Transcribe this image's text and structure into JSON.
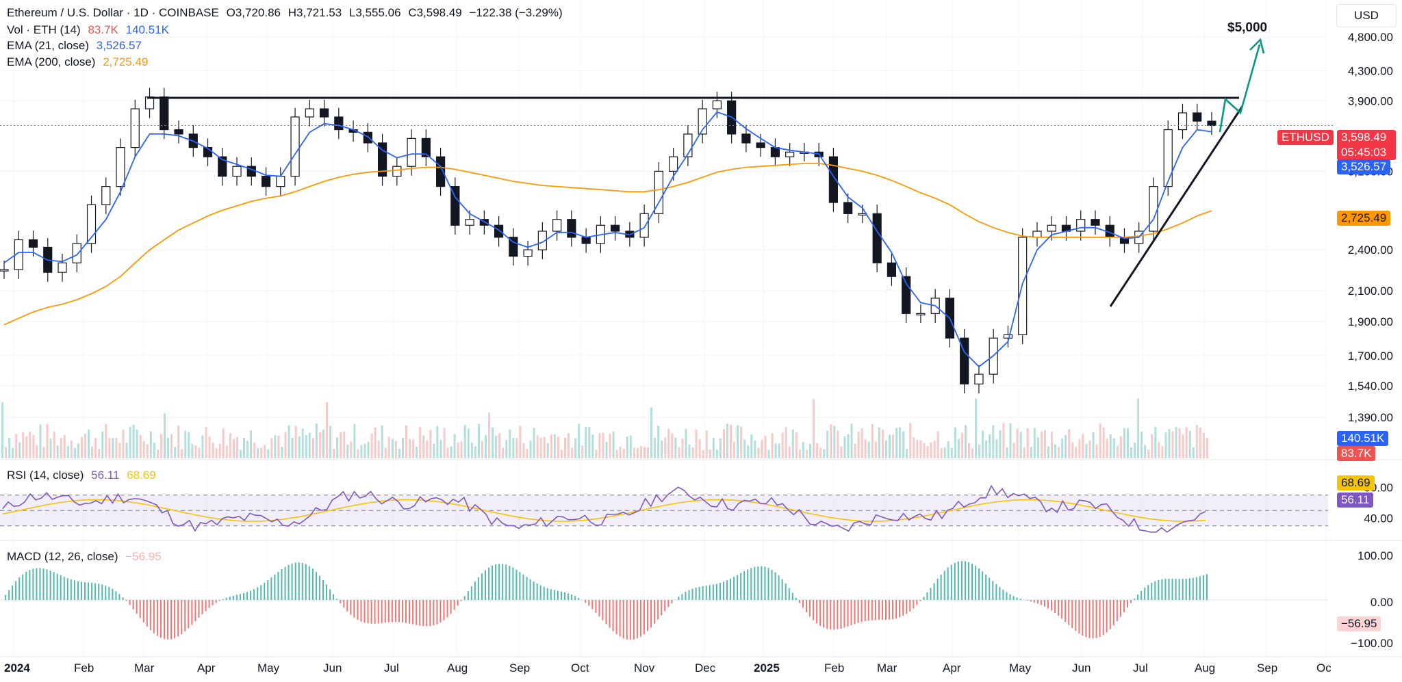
{
  "header": {
    "title": "Ethereum / U.S. Dollar · 1D · COINBASE",
    "open": "O3,720.86",
    "high": "H3,721.53",
    "low": "L3,555.06",
    "close": "C3,598.49",
    "change": "−122.38 (−3.29%)"
  },
  "indicators": {
    "vol": {
      "label": "Vol · ETH (14)",
      "v1": "83.7K",
      "v2": "140.51K"
    },
    "ema21": {
      "label": "EMA (21, close)",
      "value": "3,526.57"
    },
    "ema200": {
      "label": "EMA (200, close)",
      "value": "2,725.49"
    },
    "rsi": {
      "label": "RSI (14, close)",
      "value": "56.11",
      "ma": "68.69"
    },
    "macd": {
      "label": "MACD (12, 26, close)",
      "value": "−56.95"
    }
  },
  "currency": "USD",
  "price_tags": {
    "symbol": "ETHUSD",
    "last": "3,598.49",
    "countdown": "05:45:03",
    "ema21": "3,526.57",
    "ema200": "2,725.49",
    "vol_ma": "140.51K",
    "vol": "83.7K",
    "rsi_ma": "68.69",
    "rsi": "56.11",
    "macd": "−56.95"
  },
  "annotation": {
    "target": "$5,000"
  },
  "price_axis": [
    "4,800.00",
    "4,300.00",
    "3,900.00",
    "3,100.00",
    "2,400.00",
    "2,100.00",
    "1,900.00",
    "1,700.00",
    "1,540.00",
    "1,390.00"
  ],
  "rsi_axis": [
    "80.00",
    "40.00"
  ],
  "macd_axis": [
    "100.00",
    "0.00",
    "−100.00"
  ],
  "time_axis": [
    "2024",
    "Feb",
    "Mar",
    "Apr",
    "May",
    "Jun",
    "Jul",
    "Aug",
    "Sep",
    "Oct",
    "Nov",
    "Dec",
    "2025",
    "Feb",
    "Mar",
    "Apr",
    "May",
    "Jun",
    "Jul",
    "Aug",
    "Sep",
    "Oc"
  ],
  "colors": {
    "up": "#26a69a",
    "down": "#ef5350",
    "ema21": "#2962ff",
    "ema200": "#ff9800",
    "rsi": "#7e57c2",
    "rsi_ma": "#f5c400",
    "vol_ma": "#2962ff"
  },
  "chart_data": {
    "type": "candlestick",
    "scale": "log",
    "y_range": [
      1350,
      5000
    ],
    "dates": [
      "2024-01-01",
      "2024-01-08",
      "2024-01-15",
      "2024-01-22",
      "2024-01-29",
      "2024-02-05",
      "2024-02-12",
      "2024-02-19",
      "2024-02-26",
      "2024-03-04",
      "2024-03-11",
      "2024-03-18",
      "2024-03-25",
      "2024-04-01",
      "2024-04-08",
      "2024-04-15",
      "2024-04-22",
      "2024-04-29",
      "2024-05-06",
      "2024-05-13",
      "2024-05-20",
      "2024-05-27",
      "2024-06-03",
      "2024-06-10",
      "2024-06-17",
      "2024-06-24",
      "2024-07-01",
      "2024-07-08",
      "2024-07-15",
      "2024-07-22",
      "2024-07-29",
      "2024-08-05",
      "2024-08-12",
      "2024-08-19",
      "2024-08-26",
      "2024-09-02",
      "2024-09-09",
      "2024-09-16",
      "2024-09-23",
      "2024-09-30",
      "2024-10-07",
      "2024-10-14",
      "2024-10-21",
      "2024-10-28",
      "2024-11-04",
      "2024-11-11",
      "2024-11-18",
      "2024-11-25",
      "2024-12-02",
      "2024-12-09",
      "2024-12-16",
      "2024-12-23",
      "2024-12-30",
      "2025-01-06",
      "2025-01-13",
      "2025-01-20",
      "2025-01-27",
      "2025-02-03",
      "2025-02-10",
      "2025-02-17",
      "2025-02-24",
      "2025-03-03",
      "2025-03-10",
      "2025-03-17",
      "2025-03-24",
      "2025-03-31",
      "2025-04-07",
      "2025-04-14",
      "2025-04-21",
      "2025-04-28",
      "2025-05-05",
      "2025-05-12",
      "2025-05-19",
      "2025-05-26",
      "2025-06-02",
      "2025-06-09",
      "2025-06-16",
      "2025-06-23",
      "2025-06-30",
      "2025-07-07",
      "2025-07-14",
      "2025-07-21",
      "2025-07-28",
      "2025-08-04"
    ],
    "close": [
      2250,
      2480,
      2420,
      2230,
      2300,
      2450,
      2780,
      2950,
      3350,
      3800,
      3950,
      3550,
      3500,
      3350,
      3250,
      3050,
      3150,
      3050,
      2950,
      3050,
      3700,
      3800,
      3700,
      3550,
      3520,
      3400,
      3050,
      3150,
      3450,
      3250,
      2950,
      2600,
      2650,
      2600,
      2500,
      2350,
      2400,
      2550,
      2650,
      2500,
      2450,
      2600,
      2550,
      2500,
      2700,
      3100,
      3250,
      3500,
      3800,
      3900,
      3500,
      3400,
      3350,
      3250,
      3300,
      3300,
      3250,
      2800,
      2700,
      2700,
      2300,
      2200,
      1950,
      1950,
      2050,
      1800,
      1550,
      1600,
      1800,
      1820,
      2500,
      2550,
      2600,
      2550,
      2650,
      2600,
      2500,
      2450,
      2550,
      2950,
      3550,
      3750,
      3650,
      3598.49
    ],
    "ema21": [
      2300,
      2380,
      2380,
      2320,
      2310,
      2360,
      2500,
      2650,
      2900,
      3250,
      3500,
      3500,
      3480,
      3420,
      3340,
      3220,
      3170,
      3120,
      3060,
      3050,
      3280,
      3520,
      3620,
      3600,
      3550,
      3470,
      3320,
      3240,
      3280,
      3280,
      3150,
      2850,
      2700,
      2630,
      2560,
      2460,
      2420,
      2460,
      2540,
      2540,
      2500,
      2520,
      2540,
      2520,
      2580,
      2800,
      3050,
      3280,
      3550,
      3760,
      3700,
      3560,
      3450,
      3350,
      3320,
      3300,
      3280,
      3050,
      2850,
      2750,
      2550,
      2380,
      2150,
      2020,
      2000,
      1920,
      1720,
      1640,
      1700,
      1780,
      2150,
      2400,
      2520,
      2550,
      2580,
      2580,
      2540,
      2490,
      2500,
      2650,
      3000,
      3350,
      3550,
      3526.57
    ],
    "ema200": [
      1880,
      1920,
      1960,
      1990,
      2010,
      2040,
      2080,
      2130,
      2200,
      2300,
      2400,
      2480,
      2560,
      2620,
      2680,
      2730,
      2770,
      2810,
      2840,
      2860,
      2900,
      2950,
      3000,
      3040,
      3070,
      3090,
      3100,
      3110,
      3130,
      3140,
      3140,
      3120,
      3090,
      3060,
      3030,
      3000,
      2980,
      2960,
      2950,
      2940,
      2930,
      2920,
      2910,
      2900,
      2900,
      2920,
      2950,
      2990,
      3040,
      3090,
      3120,
      3140,
      3150,
      3160,
      3170,
      3180,
      3180,
      3160,
      3130,
      3100,
      3060,
      3010,
      2950,
      2890,
      2840,
      2780,
      2700,
      2630,
      2580,
      2540,
      2510,
      2500,
      2500,
      2500,
      2500,
      2500,
      2500,
      2500,
      2510,
      2530,
      2570,
      2620,
      2680,
      2725.49
    ]
  }
}
